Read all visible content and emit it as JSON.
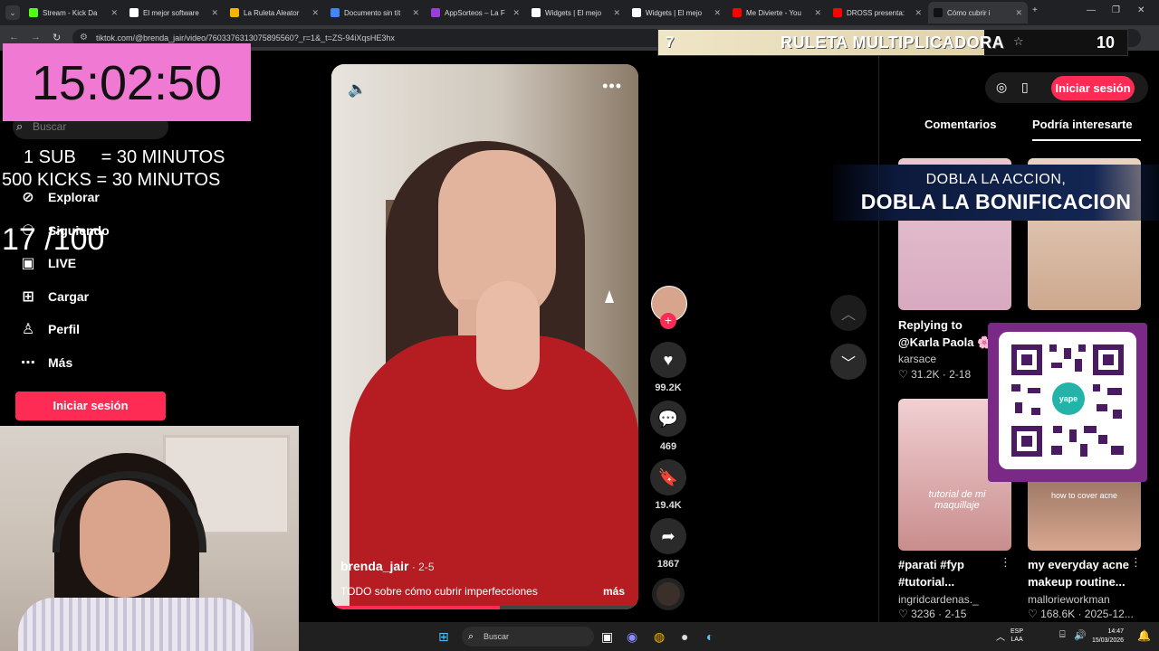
{
  "browser": {
    "tabs": [
      {
        "label": "Stream - Kick Da",
        "color": "#53fc18"
      },
      {
        "label": "El mejor software",
        "color": "#ffffff"
      },
      {
        "label": "La Ruleta Aleator",
        "color": "#f4b400"
      },
      {
        "label": "Documento sin tít",
        "color": "#4285f4"
      },
      {
        "label": "AppSorteos – La F",
        "color": "#9b3ddb"
      },
      {
        "label": "Widgets | El mejo",
        "color": "#ffffff"
      },
      {
        "label": "Widgets | El mejo",
        "color": "#ffffff"
      },
      {
        "label": "Me Divierte - You",
        "color": "#ff0000"
      },
      {
        "label": "DROSS presenta:",
        "color": "#ff0000"
      },
      {
        "label": "Cómo cubrir i",
        "color": "#111111"
      }
    ],
    "url": "tiktok.com/@brenda_jair/video/7603376313075895560?_r=1&_t=ZS-94iXqsHE3hx"
  },
  "sidebar": {
    "search_placeholder": "Buscar",
    "items": [
      {
        "label": "Explorar",
        "icon": "compass-icon"
      },
      {
        "label": "Siguiendo",
        "icon": "user-follow-icon"
      },
      {
        "label": "LIVE",
        "icon": "live-tv-icon"
      },
      {
        "label": "Cargar",
        "icon": "upload-plus-icon"
      },
      {
        "label": "Perfil",
        "icon": "profile-icon"
      },
      {
        "label": "Más",
        "icon": "more-dots-icon"
      }
    ],
    "login_label": "Iniciar sesión"
  },
  "overlay": {
    "timer": "15:02:50",
    "sub_rule": "1 SUB     = 30 MINUTOS",
    "kicks_rule": "500 KICKS = 30 MINUTOS",
    "counter": "17 /100",
    "ruleta_left": "7",
    "ruleta_title": "RULETA MULTIPLICADORA",
    "ruleta_right": "10",
    "banner_line1": "DOBLA LA ACCION,",
    "banner_line2": "DOBLA LA BONIFICACION",
    "qr_logo": "yape"
  },
  "video": {
    "author": "brenda_jair",
    "date": " · 2-5",
    "caption": "TODO sobre cómo cubrir imperfecciones",
    "more_label": "más",
    "progress": 0.55,
    "likes": "99.2K",
    "comments": "469",
    "saves": "19.4K",
    "shares": "1867"
  },
  "right_panel": {
    "login_label": "Iniciar sesión",
    "tabs": [
      "Comentarios",
      "Podría interesarte"
    ],
    "active_tab": 1,
    "cards": [
      {
        "title_line1": "Replying to",
        "title_line2": "@Karla Paola 🌸",
        "author": "karsace",
        "stats": "♡ 31.2K · 2-18"
      },
      {
        "title_line1": "#parati #fyp",
        "title_line2": "#tutorial...",
        "author": "ingridcardenas._",
        "stats": "♡ 3236 · 2-15",
        "thumb_text": "tutorial de mi maquillaje"
      },
      {
        "title_line1": "my everyday acne",
        "title_line2": "makeup routine...",
        "author": "mallorieworkman",
        "stats": "♡ 168.6K · 2025-12...",
        "thumb_text": "how to cover acne"
      }
    ]
  },
  "taskbar": {
    "search_placeholder": "Buscar",
    "lang_line1": "ESP",
    "lang_line2": "LAA",
    "time": "14:47",
    "date": "15/03/2026"
  }
}
